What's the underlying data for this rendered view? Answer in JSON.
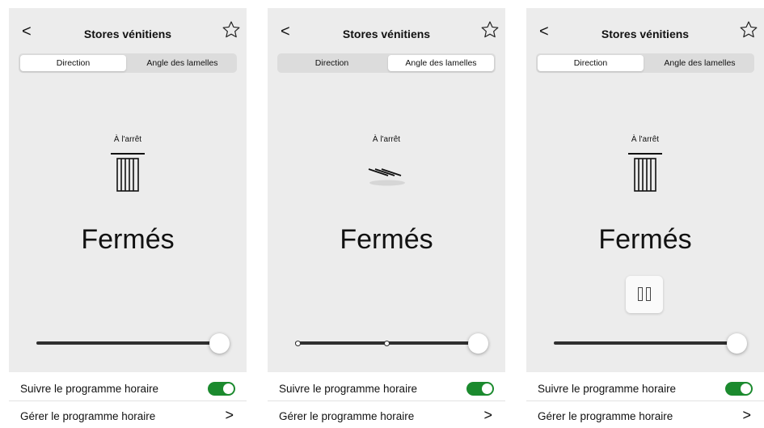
{
  "screens": [
    {
      "header": {
        "back_label": "<",
        "title": "Stores vénitiens"
      },
      "segmented": {
        "direction_label": "Direction",
        "angle_label": "Angle des lamelles",
        "selected": "Direction"
      },
      "status": "À l'arrêt",
      "icon": "closed-blind-icon",
      "state": "Fermés",
      "show_pause": false,
      "slider_value": 1.0,
      "schedule": {
        "follow_label": "Suivre le programme horaire",
        "follow_enabled": true,
        "manage_label": "Gérer le programme horaire",
        "manage_chevron": ">"
      }
    },
    {
      "header": {
        "back_label": "<",
        "title": "Stores vénitiens"
      },
      "segmented": {
        "direction_label": "Direction",
        "angle_label": "Angle des lamelles",
        "selected": "Angle des lamelles"
      },
      "status": "À l'arrêt",
      "icon": "slat-angle-icon",
      "state": "Fermés",
      "show_pause": false,
      "slider_value": 1.0,
      "schedule": {
        "follow_label": "Suivre le programme horaire",
        "follow_enabled": true,
        "manage_label": "Gérer le programme horaire",
        "manage_chevron": ">"
      }
    },
    {
      "header": {
        "back_label": "<",
        "title": "Stores vénitiens"
      },
      "segmented": {
        "direction_label": "Direction",
        "angle_label": "Angle des lamelles",
        "selected": "Direction"
      },
      "status": "À l'arrêt",
      "icon": "closed-blind-icon",
      "state": "Fermés",
      "show_pause": true,
      "slider_value": 1.0,
      "schedule": {
        "follow_label": "Suivre le programme horaire",
        "follow_enabled": true,
        "manage_label": "Gérer le programme horaire",
        "manage_chevron": ">"
      }
    }
  ],
  "colors": {
    "toggle_on": "#1b8a2e",
    "panel_bg": "#ececec",
    "track": "#2f2f2f"
  }
}
